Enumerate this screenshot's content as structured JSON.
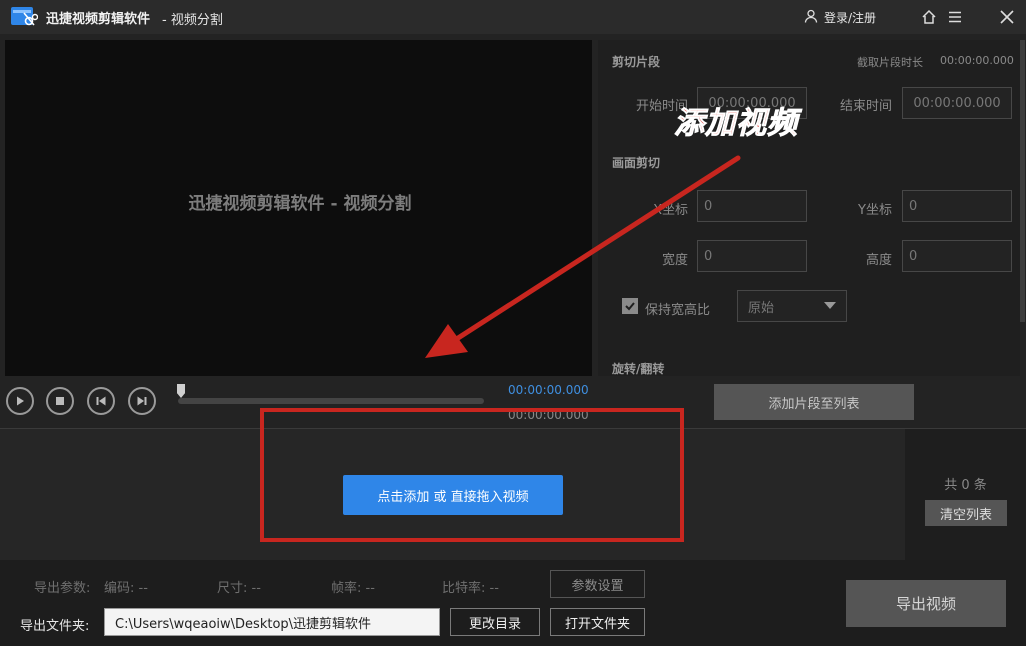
{
  "titlebar": {
    "app_name": "迅捷视频剪辑软件",
    "subtitle": "- 视频分割",
    "login": "登录/注册"
  },
  "preview": {
    "watermark_text": "迅捷视频剪辑软件 - 视频分割",
    "time_current": "00:00:00.000",
    "time_total": "00:00:00.000"
  },
  "cut": {
    "section": "剪切片段",
    "duration_label": "截取片段时长",
    "duration_value": "00:00:00.000",
    "start_label": "开始时间",
    "start_value": "00:00:00.000",
    "end_label": "结束时间",
    "end_value": "00:00:00.000"
  },
  "crop": {
    "section": "画面剪切",
    "x_label": "X坐标",
    "x_value": "0",
    "y_label": "Y坐标",
    "y_value": "0",
    "w_label": "宽度",
    "w_value": "0",
    "h_label": "高度",
    "h_value": "0",
    "keep_ratio_label": "保持宽高比",
    "ratio_value": "原始"
  },
  "rotate": {
    "section": "旋转/翻转"
  },
  "add_clip_button": "添加片段至列表",
  "list": {
    "add_video_button": "点击添加 或 直接拖入视频",
    "count": "共 0 条",
    "clear_button": "清空列表"
  },
  "export": {
    "params_label": "导出参数:",
    "codec": "编码: --",
    "size": "尺寸: --",
    "fps": "帧率: --",
    "bitrate": "比特率: --",
    "param_settings_button": "参数设置",
    "folder_label": "导出文件夹:",
    "folder_path": "C:\\Users\\wqeaoiw\\Desktop\\迅捷剪辑软件",
    "change_dir_button": "更改目录",
    "open_folder_button": "打开文件夹",
    "export_button": "导出视频"
  },
  "annotation": {
    "text": "添加视频",
    "color": "#c8261f"
  },
  "colors": {
    "accent_blue": "#2f86e8",
    "timecode_blue": "#3f8fe0"
  }
}
